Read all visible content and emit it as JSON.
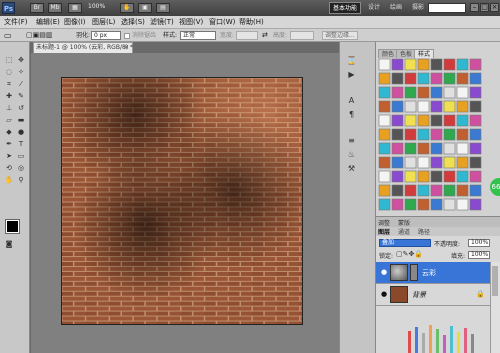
{
  "app": {
    "logo": "Ps",
    "title_icons": [
      "Br",
      "Mb"
    ],
    "zoom": "100%",
    "workspaces": [
      "基本功能",
      "设计",
      "绘画",
      "摄影"
    ],
    "window_buttons": [
      "–",
      "□",
      "×"
    ]
  },
  "menu": [
    "文件(F)",
    "编辑(E)",
    "图像(I)",
    "图层(L)",
    "选择(S)",
    "滤镜(T)",
    "视图(V)",
    "窗口(W)",
    "帮助(H)"
  ],
  "options": {
    "feather_label": "羽化:",
    "feather_value": "0 px",
    "antialias_label": "消除锯齿",
    "style_label": "样式:",
    "style_value": "正常",
    "width_label": "宽度:",
    "height_label": "高度:",
    "refine_label": "调整边缘..."
  },
  "document": {
    "tab_title": "未标题-1 @ 100% (云彩, RGB/8) *",
    "close": "×"
  },
  "panels": {
    "top_tabs": [
      "颜色",
      "色板",
      "样式"
    ],
    "layer_tabs_top": [
      "调整",
      "蒙版"
    ],
    "layer_tabs": [
      "图层",
      "通道",
      "路径"
    ],
    "blend_mode": "叠加",
    "opacity_label": "不透明度:",
    "opacity_value": "100%",
    "lock_label": "锁定:",
    "fill_label": "填充:",
    "fill_value": "100%",
    "layers": [
      {
        "name": "云彩",
        "selected": true
      },
      {
        "name": "背景",
        "selected": false
      }
    ],
    "badge": "66"
  },
  "colors": {
    "brick": "#8a4a2a",
    "mortar": "#b88a6a",
    "selection": "#3875d7"
  }
}
